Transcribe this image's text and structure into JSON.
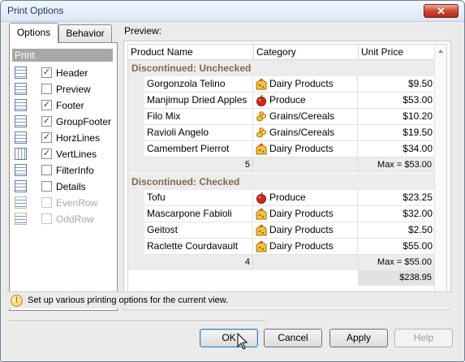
{
  "window": {
    "title": "Print Options",
    "close_glyph": "✕"
  },
  "tabs": {
    "options": "Options",
    "behavior": "Behavior"
  },
  "print_section": {
    "header": "Print",
    "options": [
      {
        "label": "Header",
        "checked": true,
        "enabled": true,
        "icon": "header-icon"
      },
      {
        "label": "Preview",
        "checked": false,
        "enabled": true,
        "icon": "preview-icon"
      },
      {
        "label": "Footer",
        "checked": true,
        "enabled": true,
        "icon": "footer-icon"
      },
      {
        "label": "GroupFooter",
        "checked": true,
        "enabled": true,
        "icon": "group-footer-icon"
      },
      {
        "label": "HorzLines",
        "checked": true,
        "enabled": true,
        "icon": "horz-lines-icon"
      },
      {
        "label": "VertLines",
        "checked": true,
        "enabled": true,
        "icon": "vert-lines-icon"
      },
      {
        "label": "FilterInfo",
        "checked": false,
        "enabled": true,
        "icon": "filter-info-icon"
      },
      {
        "label": "Details",
        "checked": false,
        "enabled": true,
        "icon": "details-icon"
      },
      {
        "label": "EvenRow",
        "checked": false,
        "enabled": false,
        "icon": "even-row-icon"
      },
      {
        "label": "OddRow",
        "checked": false,
        "enabled": false,
        "icon": "odd-row-icon"
      }
    ]
  },
  "preview": {
    "label": "Preview:",
    "columns": [
      "Product Name",
      "Category",
      "Unit Price"
    ],
    "groups": [
      {
        "title": "Discontinued: Unchecked",
        "rows": [
          {
            "name": "Gorgonzola Telino",
            "category": "Dairy Products",
            "icon": "dairy-icon",
            "price": "$9.50"
          },
          {
            "name": "Manjimup Dried Apples",
            "category": "Produce",
            "icon": "produce-icon",
            "price": "$53.00"
          },
          {
            "name": "Filo Mix",
            "category": "Grains/Cereals",
            "icon": "grains-icon",
            "price": "$10.20"
          },
          {
            "name": "Ravioli Angelo",
            "category": "Grains/Cereals",
            "icon": "grains-icon",
            "price": "$19.50"
          },
          {
            "name": "Camembert Pierrot",
            "category": "Dairy Products",
            "icon": "dairy-icon",
            "price": "$34.00"
          }
        ],
        "count": "5",
        "max": "Max = $53.00"
      },
      {
        "title": "Discontinued: Checked",
        "rows": [
          {
            "name": "Tofu",
            "category": "Produce",
            "icon": "produce-icon",
            "price": "$23.25"
          },
          {
            "name": "Mascarpone Fabioli",
            "category": "Dairy Products",
            "icon": "dairy-icon",
            "price": "$32.00"
          },
          {
            "name": "Geitost",
            "category": "Dairy Products",
            "icon": "dairy-icon",
            "price": "$2.50"
          },
          {
            "name": "Raclette Courdavault",
            "category": "Dairy Products",
            "icon": "dairy-icon",
            "price": "$55.00"
          }
        ],
        "count": "4",
        "max": "Max = $55.00"
      }
    ],
    "total": "$238.95"
  },
  "status": {
    "icon": "hint-icon",
    "text": "Set up various printing options for the current view."
  },
  "buttons": {
    "ok": "OK",
    "cancel": "Cancel",
    "apply": "Apply",
    "help": "Help"
  },
  "colors": {
    "group_text": "#7e6a4e",
    "title_bar": "#dbe7f6",
    "close_button": "#cf4b34"
  }
}
